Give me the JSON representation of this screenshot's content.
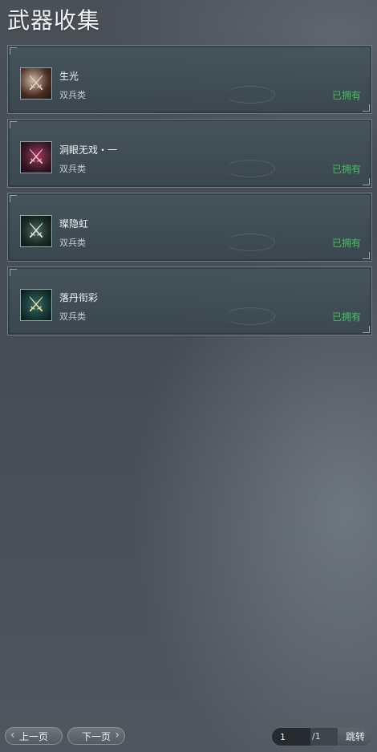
{
  "page": {
    "title": "武器收集"
  },
  "weapons": [
    {
      "name": "生光",
      "type": "双兵类",
      "status": "已拥有",
      "icon": "twin-blade-icon"
    },
    {
      "name": "洞眼无戏・一",
      "type": "双兵类",
      "status": "已拥有",
      "icon": "twin-blade-icon"
    },
    {
      "name": "璨隐虹",
      "type": "双兵类",
      "status": "已拥有",
      "icon": "twin-blade-icon"
    },
    {
      "name": "落丹衔彩",
      "type": "双兵类",
      "status": "已拥有",
      "icon": "twin-blade-icon"
    }
  ],
  "pager": {
    "prev_label": "上一页",
    "next_label": "下一页",
    "current_page": "1",
    "total_pages": "/1",
    "jump_label": "跳转"
  },
  "colors": {
    "owned": "#44c060",
    "background": "#4a5058"
  }
}
